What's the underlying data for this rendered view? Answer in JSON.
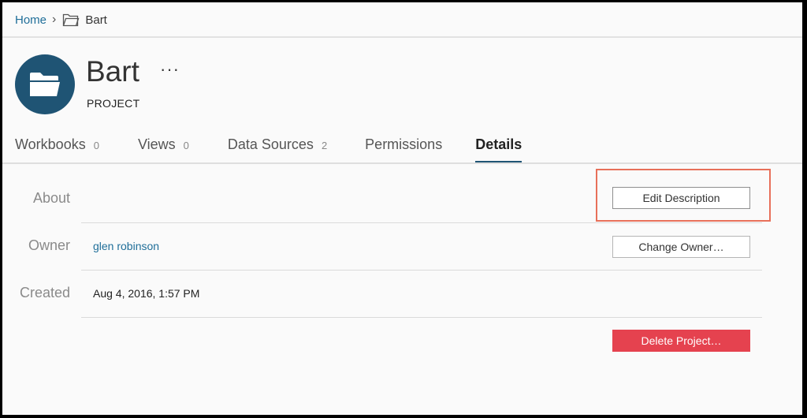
{
  "breadcrumb": {
    "home_label": "Home",
    "separator": "›",
    "folder_icon": "folder-outline-icon",
    "current_label": "Bart"
  },
  "project": {
    "avatar_icon": "folder-icon",
    "avatar_color": "#1f5474",
    "name": "Bart",
    "more_label": "···",
    "type_label": "PROJECT"
  },
  "tabs": [
    {
      "label": "Workbooks",
      "count": "0"
    },
    {
      "label": "Views",
      "count": "0"
    },
    {
      "label": "Data Sources",
      "count": "2"
    },
    {
      "label": "Permissions"
    },
    {
      "label": "Details",
      "active": true
    }
  ],
  "details": {
    "about_label": "About",
    "owner_label": "Owner",
    "owner_value": "glen robinson",
    "created_label": "Created",
    "created_value": "Aug 4, 2016, 1:57 PM",
    "edit_description_button": "Edit Description",
    "change_owner_button": "Change Owner…",
    "delete_project_button": "Delete Project…"
  },
  "colors": {
    "link": "#1f6e99",
    "active_tab_underline": "#1f5474",
    "delete_button": "#e5424f",
    "annotation_box": "#e8705a"
  }
}
